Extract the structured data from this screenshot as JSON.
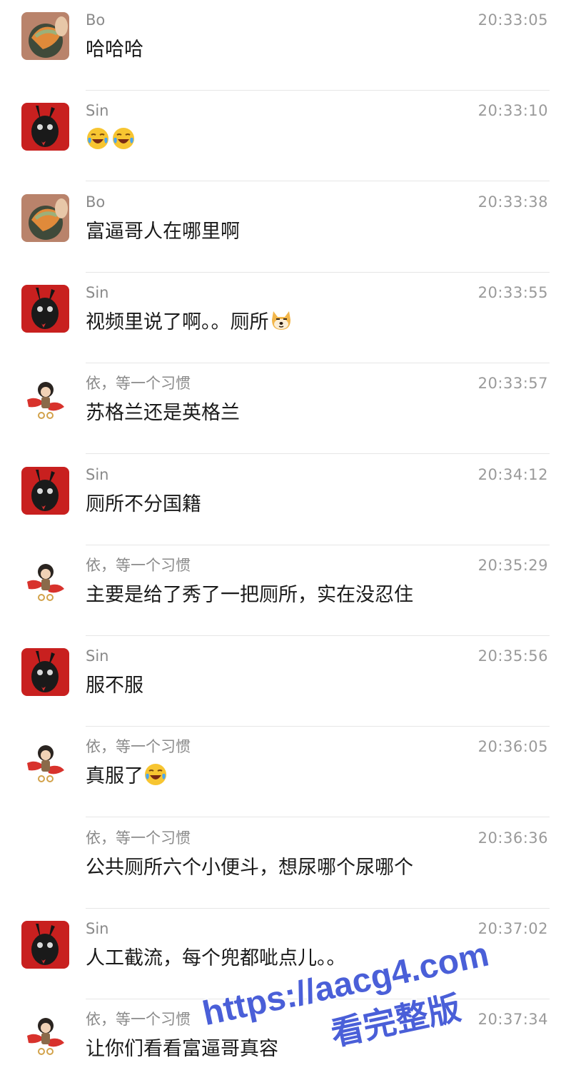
{
  "messages": [
    {
      "sender": "Bo",
      "time": "20:33:05",
      "text": "哈哈哈",
      "avatar": "bo-avatar",
      "emojis": []
    },
    {
      "sender": "Sin",
      "time": "20:33:10",
      "text": "",
      "avatar": "sin-avatar",
      "emojis": [
        "laugh-cry-emoji",
        "laugh-cry-emoji"
      ]
    },
    {
      "sender": "Bo",
      "time": "20:33:38",
      "text": "富逼哥人在哪里啊",
      "avatar": "bo-avatar",
      "emojis": []
    },
    {
      "sender": "Sin",
      "time": "20:33:55",
      "text": "视频里说了啊。。厕所",
      "avatar": "sin-avatar",
      "emojis": [
        "doge-emoji"
      ]
    },
    {
      "sender": "依，等一个习惯",
      "time": "20:33:57",
      "text": "苏格兰还是英格兰",
      "avatar": "yi-avatar",
      "emojis": []
    },
    {
      "sender": "Sin",
      "time": "20:34:12",
      "text": "厕所不分国籍",
      "avatar": "sin-avatar",
      "emojis": []
    },
    {
      "sender": "依，等一个习惯",
      "time": "20:35:29",
      "text": "主要是给了秀了一把厕所，实在没忍住",
      "avatar": "yi-avatar",
      "emojis": []
    },
    {
      "sender": "Sin",
      "time": "20:35:56",
      "text": "服不服",
      "avatar": "sin-avatar",
      "emojis": []
    },
    {
      "sender": "依，等一个习惯",
      "time": "20:36:05",
      "text": "真服了",
      "avatar": "yi-avatar",
      "emojis": [
        "laugh-cry-emoji"
      ]
    },
    {
      "sender": "依，等一个习惯",
      "time": "20:36:36",
      "text": "公共厕所六个小便斗，想尿哪个尿哪个",
      "avatar": "",
      "emojis": []
    },
    {
      "sender": "Sin",
      "time": "20:37:02",
      "text": "人工截流，每个兜都呲点儿。。",
      "avatar": "sin-avatar",
      "emojis": []
    },
    {
      "sender": "依，等一个习惯",
      "time": "20:37:34",
      "text": "让你们看看富逼哥真容",
      "avatar": "yi-avatar",
      "emojis": []
    }
  ],
  "watermark": {
    "line1": "https://aacg4.com",
    "line2": "看完整版"
  },
  "colors": {
    "text": "#1a1a1a",
    "meta": "#8a8a8a",
    "divider": "#e6e6e6",
    "watermark": "#4a5fd8"
  }
}
